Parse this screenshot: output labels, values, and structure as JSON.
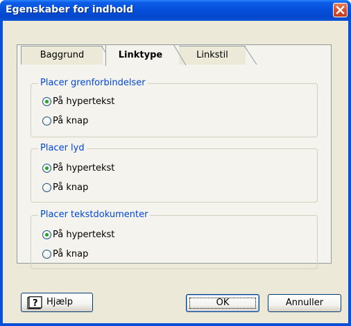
{
  "window": {
    "title": "Egenskaber for indhold"
  },
  "tabs": [
    {
      "label": "Baggrund",
      "active": false
    },
    {
      "label": "Linktype",
      "active": true
    },
    {
      "label": "Linkstil",
      "active": false
    }
  ],
  "groups": [
    {
      "legend": "Placer grenforbindelser",
      "options": [
        {
          "label": "På hypertekst",
          "checked": true
        },
        {
          "label": "På knap",
          "checked": false
        }
      ]
    },
    {
      "legend": "Placer lyd",
      "options": [
        {
          "label": "På hypertekst",
          "checked": true
        },
        {
          "label": "På knap",
          "checked": false
        }
      ]
    },
    {
      "legend": "Placer tekstdokumenter",
      "options": [
        {
          "label": "På hypertekst",
          "checked": true
        },
        {
          "label": "På knap",
          "checked": false
        }
      ]
    }
  ],
  "buttons": {
    "help": "Hjælp",
    "ok": "OK",
    "cancel": "Annuller"
  },
  "icons": {
    "close": "close-icon",
    "help": "help-book-icon"
  },
  "colors": {
    "title_bar": "#0650dc",
    "legend_text": "#0046d5",
    "radio_dot": "#21a121",
    "face": "#ece9d8"
  }
}
